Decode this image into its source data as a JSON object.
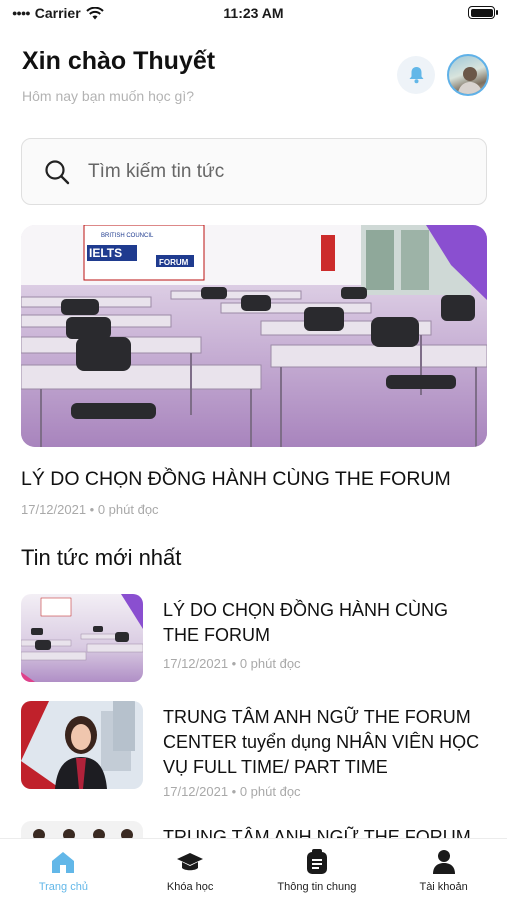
{
  "status_bar": {
    "carrier": "Carrier",
    "time": "11:23 AM"
  },
  "header": {
    "greeting": "Xin chào Thuyết",
    "subtitle": "Hôm nay bạn muốn học gì?"
  },
  "search": {
    "placeholder": "Tìm kiếm tin tức"
  },
  "featured": {
    "image_label": "IELTS",
    "image_brand": "BRITISH COUNCIL",
    "image_partner": "FORUM",
    "title": "LÝ DO CHỌN ĐỒNG HÀNH CÙNG THE FORUM",
    "meta": "17/12/2021 • 0 phút đọc"
  },
  "latest": {
    "section_title": "Tin tức mới nhất",
    "items": [
      {
        "title": "LÝ DO CHỌN ĐỒNG HÀNH CÙNG THE FORUM",
        "meta": "17/12/2021 • 0 phút đọc"
      },
      {
        "title": "TRUNG TÂM ANH NGỮ THE FORUM CENTER tuyển dụng NHÂN VIÊN HỌC VỤ FULL TIME/ PART TIME",
        "meta": "17/12/2021 • 0 phút đọc"
      },
      {
        "title": "TRUNG TÂM ANH NGỮ THE FORUM",
        "meta": ""
      }
    ]
  },
  "tabs": [
    {
      "label": "Trang chủ",
      "icon": "home-icon",
      "active": true
    },
    {
      "label": "Khóa học",
      "icon": "graduation-cap-icon",
      "active": false
    },
    {
      "label": "Thông tin chung",
      "icon": "info-card-icon",
      "active": false
    },
    {
      "label": "Tài khoản",
      "icon": "user-icon",
      "active": false
    }
  ],
  "colors": {
    "accent": "#62b7e8",
    "text": "#111111",
    "muted": "#a9a9a9",
    "tab_inactive": "#222222"
  }
}
